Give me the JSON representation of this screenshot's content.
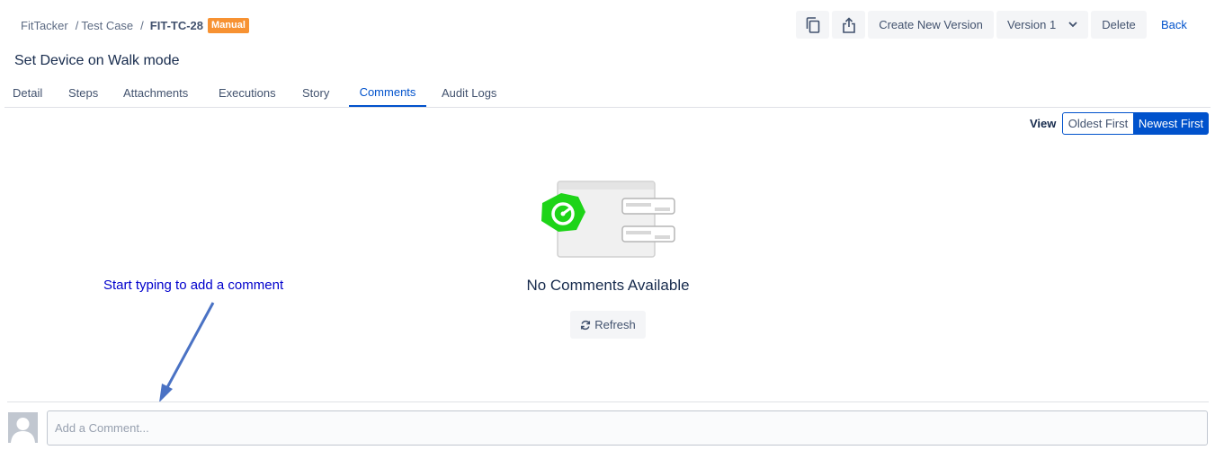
{
  "breadcrumb": {
    "project": "FitTacker",
    "section": "Test Case",
    "separator": "/",
    "key": "FIT-TC-28",
    "badge": "Manual"
  },
  "toolbar": {
    "copy_icon": "copy-icon",
    "share_icon": "share-icon",
    "create_version_label": "Create New Version",
    "version_label": "Version 1",
    "delete_label": "Delete",
    "back_label": "Back"
  },
  "page_title": "Set Device on Walk mode",
  "tabs": [
    {
      "label": "Detail",
      "active": false
    },
    {
      "label": "Steps",
      "active": false
    },
    {
      "label": "Attachments",
      "active": false
    },
    {
      "label": "Executions",
      "active": false
    },
    {
      "label": "Story",
      "active": false
    },
    {
      "label": "Comments",
      "active": true
    },
    {
      "label": "Audit Logs",
      "active": false
    }
  ],
  "view": {
    "label": "View",
    "options": [
      "Oldest First",
      "Newest First"
    ],
    "selected": "Newest First"
  },
  "empty_state": {
    "title": "No Comments Available",
    "refresh_label": "Refresh"
  },
  "annotation": "Start typing to add a comment",
  "comment": {
    "placeholder": "Add a Comment..."
  },
  "colors": {
    "accent": "#0052cc",
    "badge": "#f79232",
    "annotation": "#0000cc",
    "arrow": "#4a72c4",
    "illustration_green": "#1ed418"
  }
}
